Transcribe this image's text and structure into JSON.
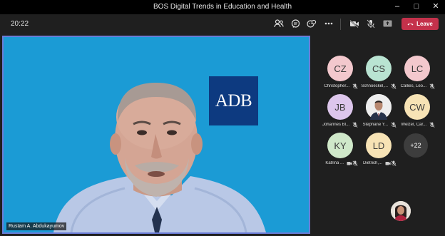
{
  "window": {
    "title": "BOS Digital Trends in Education and Health"
  },
  "toolbar": {
    "time": "20:22",
    "leave_label": "Leave"
  },
  "stage": {
    "speaker_name": "Rustam A. Abdukayumov",
    "logo_text": "ADB",
    "background_color": "#1b9bd5"
  },
  "participants": [
    {
      "initials": "CZ",
      "name": "Christopher...",
      "color": "#f3c8cd",
      "icons": [
        "mic-off-icon"
      ]
    },
    {
      "initials": "CS",
      "name": "Schnoeckel,...",
      "color": "#b9e4d2",
      "icons": [
        "mic-off-icon"
      ]
    },
    {
      "initials": "LC",
      "name": "Callies, Leo...",
      "color": "#f3c8cd",
      "icons": [
        "mic-off-icon"
      ]
    },
    {
      "initials": "JB",
      "name": "Johannes Bl...",
      "color": "#ddc6ec",
      "icons": [
        "mic-off-icon"
      ]
    },
    {
      "initials": "",
      "name": "Stephane Y...",
      "color": "#f5f5f5",
      "icons": [
        "mic-off-icon"
      ],
      "photo": true
    },
    {
      "initials": "CW",
      "name": "Welzel, Car...",
      "color": "#f7e3b5",
      "icons": [
        "mic-off-icon"
      ]
    },
    {
      "initials": "KY",
      "name": "Katrina ...",
      "color": "#cfe8c9",
      "icons": [
        "video-off-icon",
        "mic-off-icon"
      ]
    },
    {
      "initials": "LD",
      "name": "Dietrich,...",
      "color": "#f7e3b5",
      "icons": [
        "video-off-icon",
        "mic-off-icon"
      ]
    }
  ],
  "overflow": {
    "label": "+22"
  }
}
